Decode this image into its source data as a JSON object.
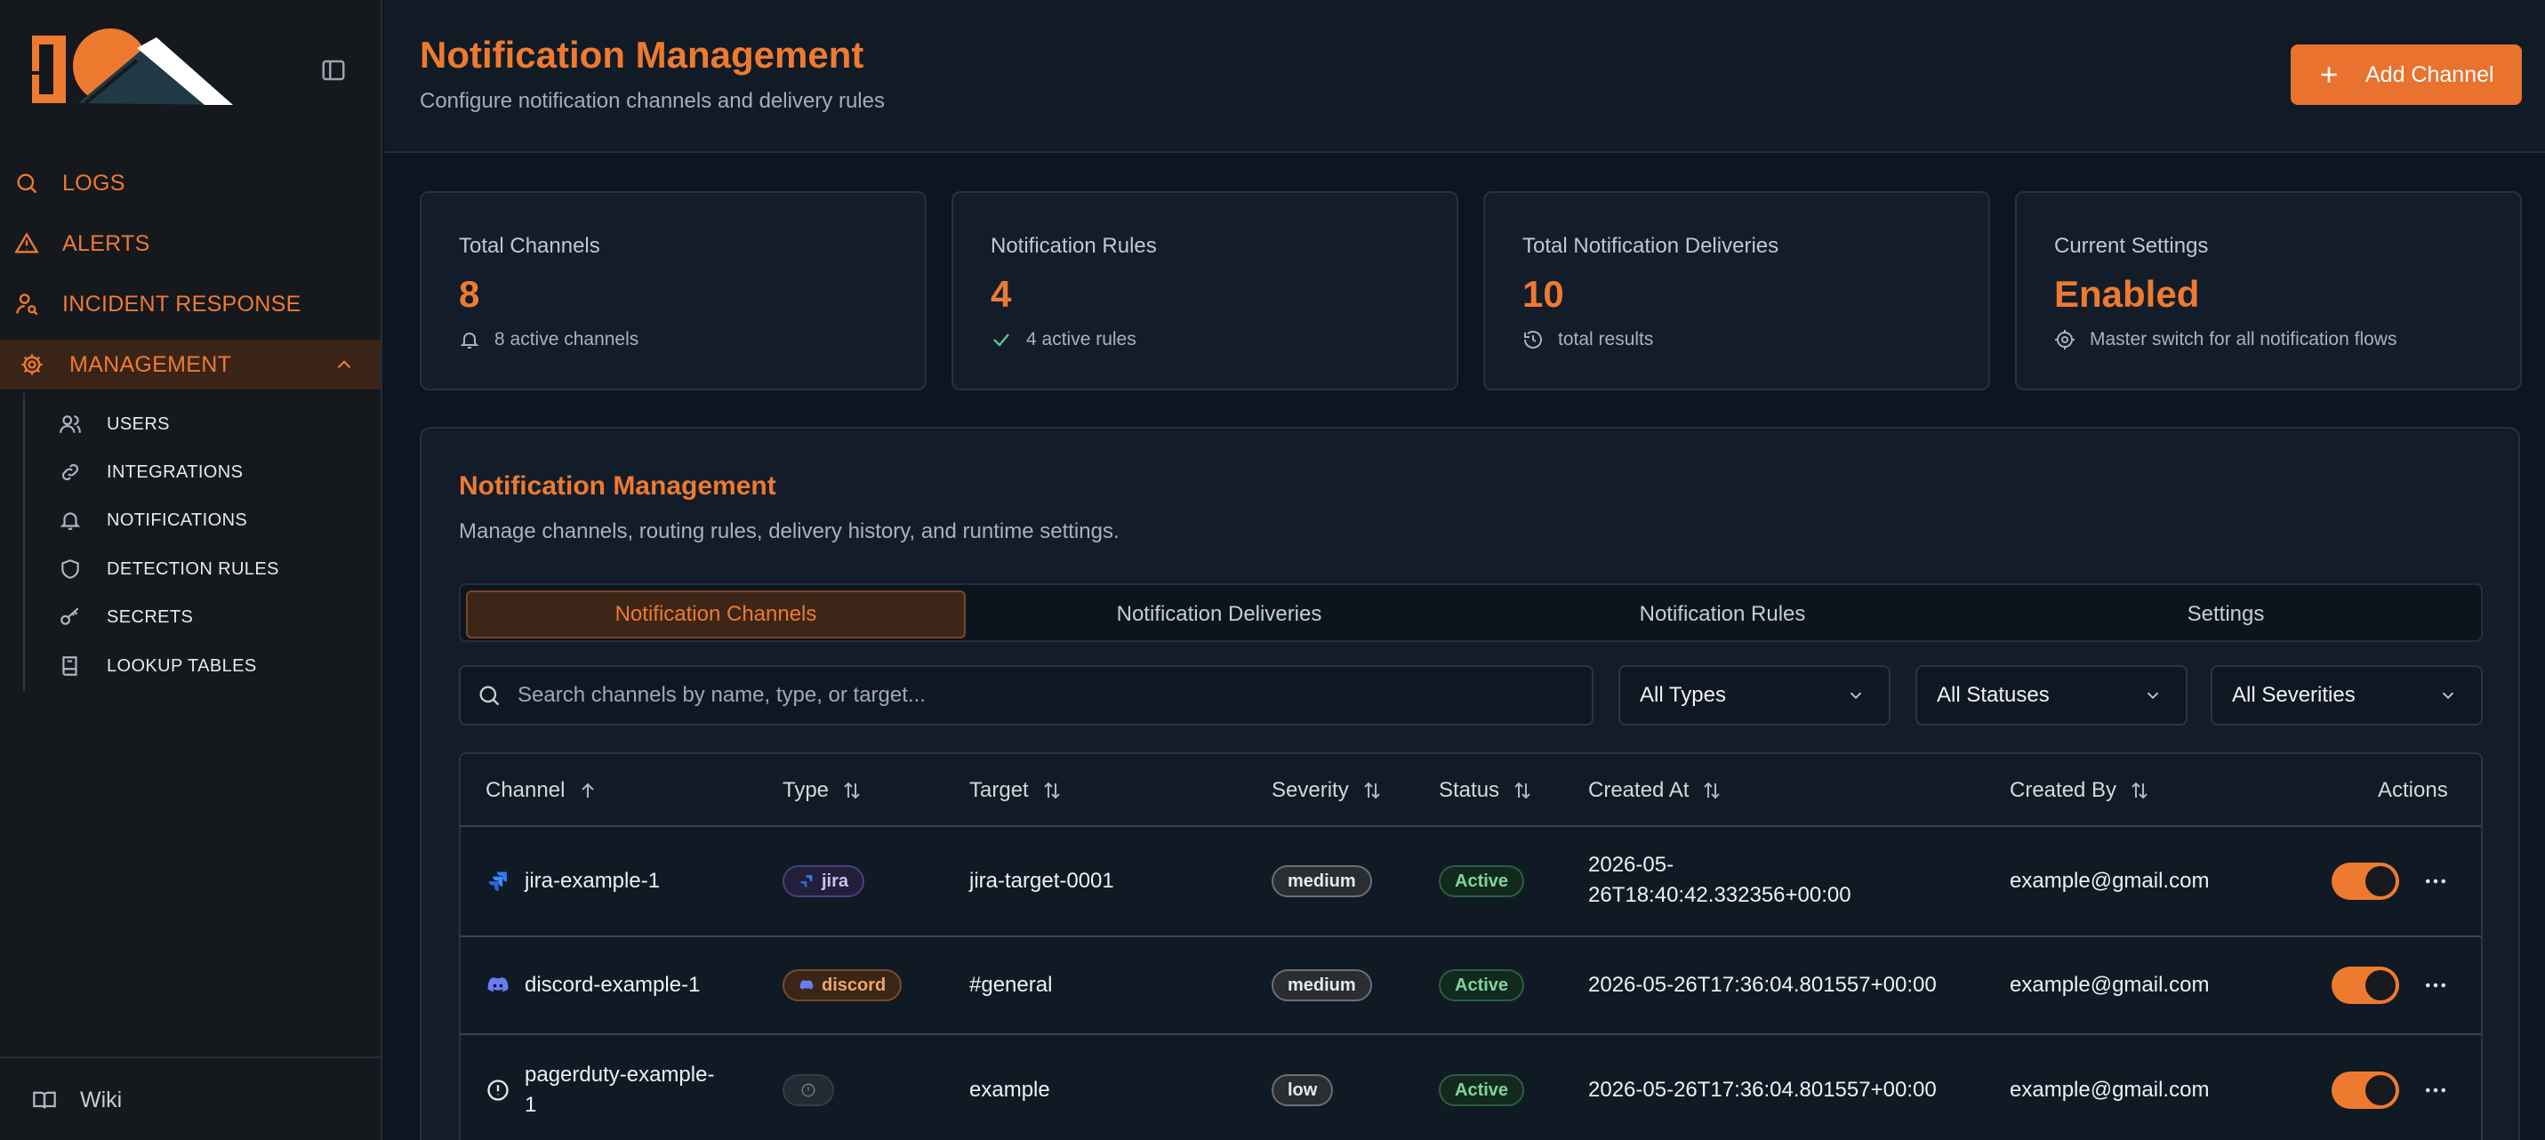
{
  "sidebar": {
    "nav": [
      {
        "label": "LOGS",
        "icon": "search-icon"
      },
      {
        "label": "ALERTS",
        "icon": "alert-triangle-icon"
      },
      {
        "label": "INCIDENT RESPONSE",
        "icon": "user-search-icon"
      },
      {
        "label": "MANAGEMENT",
        "icon": "gear-icon",
        "expanded": true
      }
    ],
    "sub": [
      {
        "label": "USERS",
        "icon": "users-icon"
      },
      {
        "label": "INTEGRATIONS",
        "icon": "link-icon"
      },
      {
        "label": "NOTIFICATIONS",
        "icon": "bell-icon"
      },
      {
        "label": "DETECTION RULES",
        "icon": "shield-icon"
      },
      {
        "label": "SECRETS",
        "icon": "key-icon"
      },
      {
        "label": "LOOKUP TABLES",
        "icon": "book-icon"
      }
    ],
    "footer": {
      "label": "Wiki",
      "icon": "book-open-icon"
    }
  },
  "header": {
    "title": "Notification Management",
    "subtitle": "Configure notification channels and delivery rules",
    "add_button": "Add Channel"
  },
  "stats": [
    {
      "title": "Total Channels",
      "value": "8",
      "note": "8 active channels",
      "icon": "bell-icon"
    },
    {
      "title": "Notification Rules",
      "value": "4",
      "note": "4 active rules",
      "icon": "check-icon"
    },
    {
      "title": "Total Notification Deliveries",
      "value": "10",
      "note": "total results",
      "icon": "history-icon"
    },
    {
      "title": "Current Settings",
      "value": "Enabled",
      "note": "Master switch for all notification flows",
      "icon": "gear-icon"
    }
  ],
  "panel": {
    "title": "Notification Management",
    "subtitle": "Manage channels, routing rules, delivery history, and runtime settings.",
    "tabs": [
      "Notification Channels",
      "Notification Deliveries",
      "Notification Rules",
      "Settings"
    ],
    "active_tab": "Notification Channels",
    "search_placeholder": "Search channels by name, type, or target...",
    "filters": [
      "All Types",
      "All Statuses",
      "All Severities"
    ]
  },
  "table": {
    "columns": [
      "Channel",
      "Type",
      "Target",
      "Severity",
      "Status",
      "Created At",
      "Created By",
      "Actions"
    ],
    "rows": [
      {
        "channel": "jira-example-1",
        "type": "jira",
        "target": "jira-target-0001",
        "severity": "medium",
        "status": "Active",
        "created_at_l1": "2026-05-",
        "created_at_l2": "26T18:40:42.332356+00:00",
        "created_by": "example@gmail.com",
        "enabled": true
      },
      {
        "channel": "discord-example-1",
        "type": "discord",
        "target": "#general",
        "severity": "medium",
        "status": "Active",
        "created_at": "2026-05-26T17:36:04.801557+00:00",
        "created_by": "example@gmail.com",
        "enabled": true
      },
      {
        "channel_l1": "pagerduty-example-",
        "channel_l2": "1",
        "type": "",
        "target": "example",
        "severity": "low",
        "status": "Active",
        "created_at": "2026-05-26T17:36:04.801557+00:00",
        "created_by": "example@gmail.com",
        "enabled": true
      }
    ]
  },
  "colors": {
    "accent": "#ee7a30",
    "background": "#0c1622",
    "sidebar": "#15181d",
    "active_green": "#7fd69c"
  }
}
